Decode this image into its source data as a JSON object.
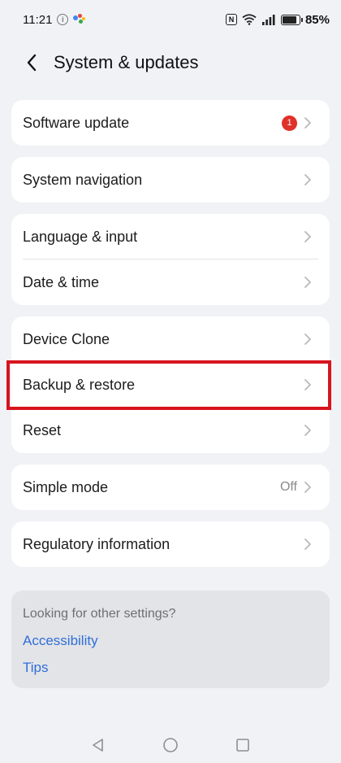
{
  "status_bar": {
    "time": "11:21",
    "battery_percent": "85%",
    "battery_level": 0.85
  },
  "header": {
    "title": "System & updates"
  },
  "groups": [
    {
      "items": [
        {
          "label": "Software update",
          "badge": "1"
        }
      ]
    },
    {
      "items": [
        {
          "label": "System navigation"
        }
      ]
    },
    {
      "items": [
        {
          "label": "Language & input"
        },
        {
          "label": "Date & time"
        }
      ]
    },
    {
      "items": [
        {
          "label": "Device Clone"
        },
        {
          "label": "Backup & restore",
          "highlighted": true
        },
        {
          "label": "Reset"
        }
      ]
    },
    {
      "items": [
        {
          "label": "Simple mode",
          "value": "Off"
        }
      ]
    },
    {
      "items": [
        {
          "label": "Regulatory information"
        }
      ]
    }
  ],
  "suggestions": {
    "title": "Looking for other settings?",
    "links": [
      "Accessibility",
      "Tips"
    ]
  },
  "colors": {
    "background": "#f1f2f6",
    "card": "#ffffff",
    "badge": "#e0302a",
    "link": "#2f6fd8",
    "highlight": "#d7141e"
  },
  "icons": {
    "back": "chevron-left-icon",
    "row_arrow": "chevron-right-icon",
    "nav": [
      "back-triangle-icon",
      "home-circle-icon",
      "recents-square-icon"
    ]
  }
}
